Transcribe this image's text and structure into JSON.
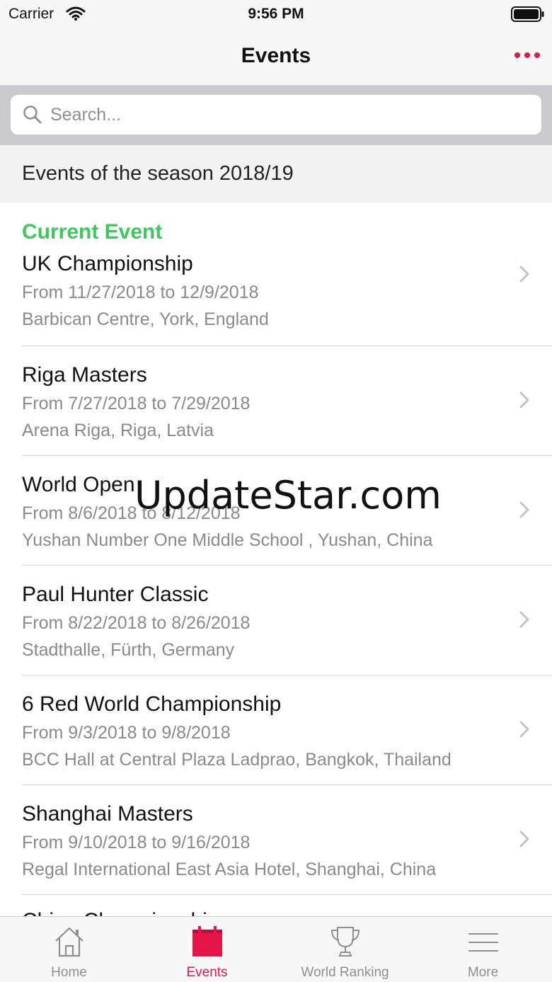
{
  "status_bar": {
    "carrier": "Carrier",
    "time": "9:56 PM"
  },
  "nav": {
    "title": "Events",
    "more_icon": "ellipsis-icon"
  },
  "search": {
    "placeholder": "Search...",
    "value": ""
  },
  "section": {
    "title": "Events of the season 2018/19"
  },
  "current_label": "Current Event",
  "events": [
    {
      "name": "UK Championship",
      "date": "From 11/27/2018 to 12/9/2018",
      "venue": "Barbican Centre, York, England"
    },
    {
      "name": "Riga Masters",
      "date": "From 7/27/2018 to 7/29/2018",
      "venue": "Arena Riga, Riga, Latvia"
    },
    {
      "name": "World Open",
      "date": "From 8/6/2018 to 8/12/2018",
      "venue": "Yushan Number One Middle School , Yushan, China"
    },
    {
      "name": "Paul Hunter Classic",
      "date": "From 8/22/2018 to 8/26/2018",
      "venue": "Stadthalle, Fürth, Germany"
    },
    {
      "name": "6 Red World Championship",
      "date": "From 9/3/2018 to 9/8/2018",
      "venue": "BCC Hall at Central Plaza Ladprao, Bangkok, Thailand"
    },
    {
      "name": "Shanghai Masters",
      "date": "From 9/10/2018 to 9/16/2018",
      "venue": "Regal International East Asia Hotel, Shanghai, China"
    }
  ],
  "partial_event": {
    "name": "China Championship"
  },
  "watermark": "UpdateStar.com",
  "tabs": [
    {
      "label": "Home",
      "icon": "home-icon"
    },
    {
      "label": "Events",
      "icon": "calendar-icon",
      "active": true
    },
    {
      "label": "World Ranking",
      "icon": "trophy-icon"
    },
    {
      "label": "More",
      "icon": "menu-icon"
    }
  ],
  "colors": {
    "accent": "#e5154a",
    "current": "#3cc95b",
    "secondary_text": "#8a8a8a"
  }
}
